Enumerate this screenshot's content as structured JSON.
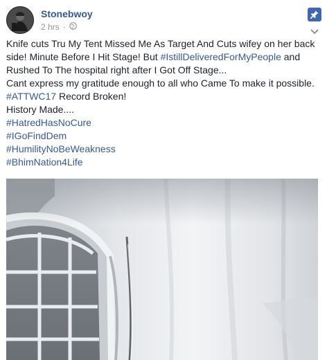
{
  "post": {
    "author": "Stonebwoy",
    "time": "2 hrs",
    "dot": "·",
    "globe_icon": "globe-icon",
    "pin_icon": "pin-icon",
    "menu_icon": "chevron-down-icon",
    "text": {
      "line1": "Knife cuts Tru My Tent Missed Me As Target And Cuts wifey on her back",
      "line2a": "side! Minute Before I Hit Stage! But ",
      "line2_tag": "#IstillDeliveredForMyPeople",
      "line2b": " and",
      "line3": "Rushed To The hospital right after I Got Off Stage...",
      "line4": "Cant express my gratitude enough to all who Came To make it possible.",
      "line5_tag": "#ATTWC17",
      "line5b": " Record Broken!",
      "line6": "History Made....",
      "tags": [
        "#HatredHasNoCure",
        "#IGoFindDem",
        "#HumilityNoBeWeakness",
        "#BhimNation4Life"
      ]
    },
    "photo_description_icon": "tent-photo"
  },
  "colors": {
    "link": "#365899",
    "meta": "#90949c",
    "pin_bg": "#4267b2",
    "text": "#1d2129"
  }
}
